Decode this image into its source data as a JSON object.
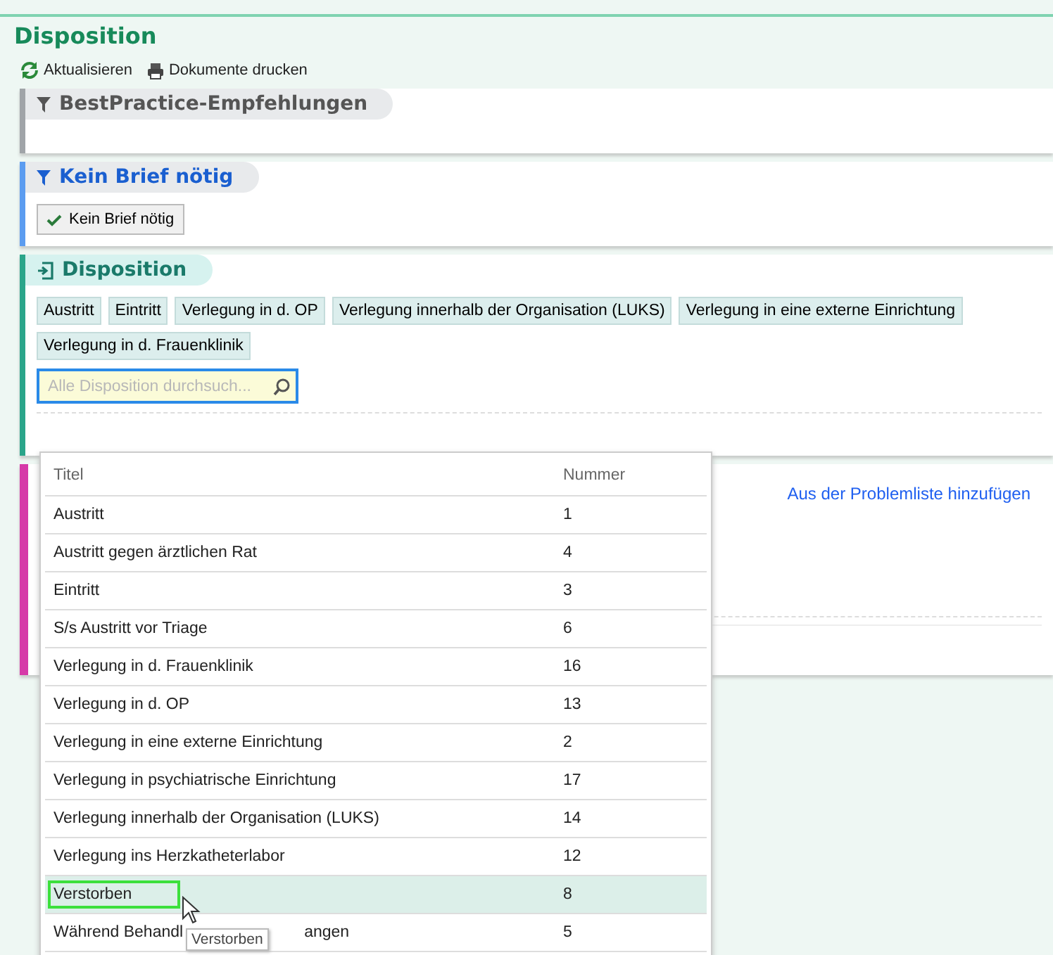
{
  "page": {
    "title": "Disposition"
  },
  "toolbar": [
    {
      "kind": "refresh",
      "label": "Aktualisieren"
    },
    {
      "kind": "print",
      "label": "Dokumente drucken"
    }
  ],
  "sections": [
    {
      "kind": "filter",
      "title": "BestPractice-Empfehlungen",
      "color": "#a0a4a8"
    },
    {
      "kind": "filter",
      "title": "Kein Brief nötig",
      "color": "#5b9cf0",
      "buttons": [
        {
          "label": "Kein Brief nötig",
          "checked": true
        }
      ]
    },
    {
      "kind": "exit",
      "title": "Disposition",
      "color": "#2aa58a",
      "chips": [
        "Austritt",
        "Eintritt",
        "Verlegung in d. OP",
        "Verlegung innerhalb der Organisation (LUKS)",
        "Verlegung in eine externe Einrichtung",
        "Verlegung in d. Frauenklinik"
      ],
      "search": {
        "placeholder": "Alle Disposition durchsuch..."
      }
    },
    {
      "kind": "problems",
      "color": "#d63aa8",
      "link": "Aus der Problemliste hinzufügen"
    }
  ],
  "dropdown": {
    "columns": [
      "Titel",
      "Nummer"
    ],
    "rows": [
      {
        "title": "Austritt",
        "number": "1",
        "selected": false
      },
      {
        "title": "Austritt gegen ärztlichen Rat",
        "number": "4",
        "selected": false
      },
      {
        "title": "Eintritt",
        "number": "3",
        "selected": false
      },
      {
        "title": "S/s Austritt vor Triage",
        "number": "6",
        "selected": false
      },
      {
        "title": "Verlegung in d. Frauenklinik",
        "number": "16",
        "selected": false
      },
      {
        "title": "Verlegung in d. OP",
        "number": "13",
        "selected": false
      },
      {
        "title": "Verlegung in eine externe Einrichtung",
        "number": "2",
        "selected": false
      },
      {
        "title": "Verlegung in psychiatrische Einrichtung",
        "number": "17",
        "selected": false
      },
      {
        "title": "Verlegung innerhalb der Organisation (LUKS)",
        "number": "14",
        "selected": false
      },
      {
        "title": "Verlegung ins Herzkatheterlabor",
        "number": "12",
        "selected": false
      },
      {
        "title": "Verstorben",
        "number": "8",
        "selected": true
      },
      {
        "title": "Während Behandl",
        "title_end": "angen",
        "number": "5",
        "selected": false
      }
    ],
    "tooltip": "Verstorben"
  }
}
